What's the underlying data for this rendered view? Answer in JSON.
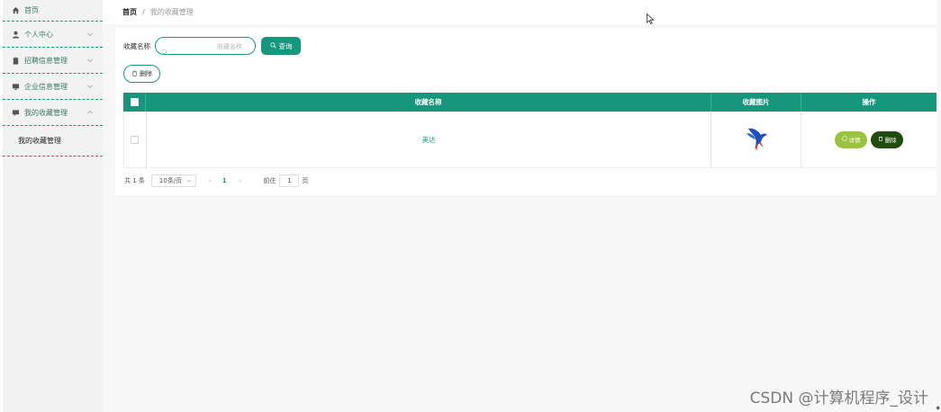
{
  "sidebar": {
    "items": [
      {
        "label": "首页",
        "icon": "home-icon"
      },
      {
        "label": "个人中心",
        "icon": "user-icon"
      },
      {
        "label": "招聘信息管理",
        "icon": "clipboard-icon"
      },
      {
        "label": "企业信息管理",
        "icon": "monitor-icon"
      },
      {
        "label": "我的收藏管理",
        "icon": "chat-icon"
      }
    ],
    "submenu": {
      "label": "我的收藏管理"
    }
  },
  "breadcrumb": {
    "home": "首页",
    "separator": "/",
    "current": "我的收藏管理"
  },
  "search": {
    "label": "收藏名称",
    "placeholder": "收藏名称",
    "button_label": "查询"
  },
  "toolbar": {
    "delete_label": "删除"
  },
  "table": {
    "columns": [
      "收藏名称",
      "收藏图片",
      "操作"
    ],
    "rows": [
      {
        "name": "美达",
        "image": "bird-logo",
        "detail_label": "详情",
        "delete_label": "删除"
      }
    ]
  },
  "pagination": {
    "total": "共 1 条",
    "page_size": "10条/页",
    "prev": "‹",
    "current": "1",
    "next": "›",
    "goto_label": "前往",
    "goto_value": "1",
    "unit": "页"
  },
  "watermark": "CSDN @计算机程序_设计",
  "colors": {
    "accent": "#16967a",
    "detail": "#9ac33e",
    "danger": "#1e4d0d",
    "sidebar_bg": "#f2f2f3"
  }
}
